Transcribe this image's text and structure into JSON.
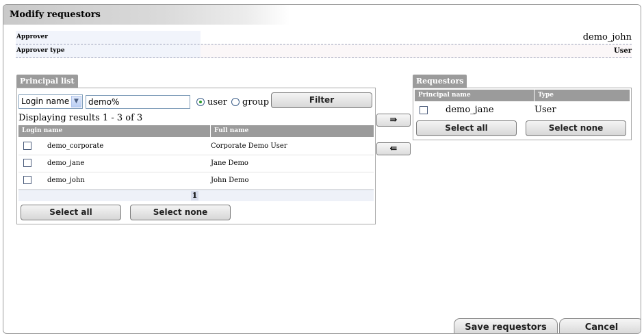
{
  "window": {
    "title": "Modify requestors"
  },
  "approver": {
    "label": "Approver",
    "value": "demo_john"
  },
  "approver_type": {
    "label": "Approver type",
    "value": "User"
  },
  "principal_list": {
    "tab_label": "Principal list",
    "search_field_select": "Login name",
    "search_text": "demo%",
    "radio_user_label": "user",
    "radio_group_label": "group",
    "selected_radio": "user",
    "filter_label": "Filter",
    "results_text": "Displaying results 1 - 3 of 3",
    "columns": [
      "Login name",
      "Full name"
    ],
    "rows": [
      {
        "login": "demo_corporate",
        "full_name": "Corporate Demo User"
      },
      {
        "login": "demo_jane",
        "full_name": "Jane Demo"
      },
      {
        "login": "demo_john",
        "full_name": "John Demo"
      }
    ],
    "page": "1",
    "select_all_label": "Select all",
    "select_none_label": "Select none"
  },
  "move": {
    "add_symbol": "⇛",
    "remove_symbol": "⇚"
  },
  "requestors": {
    "tab_label": "Requestors",
    "columns": [
      "Principal name",
      "Type"
    ],
    "rows": [
      {
        "name": "demo_jane",
        "type": "User"
      }
    ],
    "select_all_label": "Select all",
    "select_none_label": "Select none"
  },
  "footer": {
    "save_label": "Save requestors",
    "cancel_label": "Cancel"
  }
}
